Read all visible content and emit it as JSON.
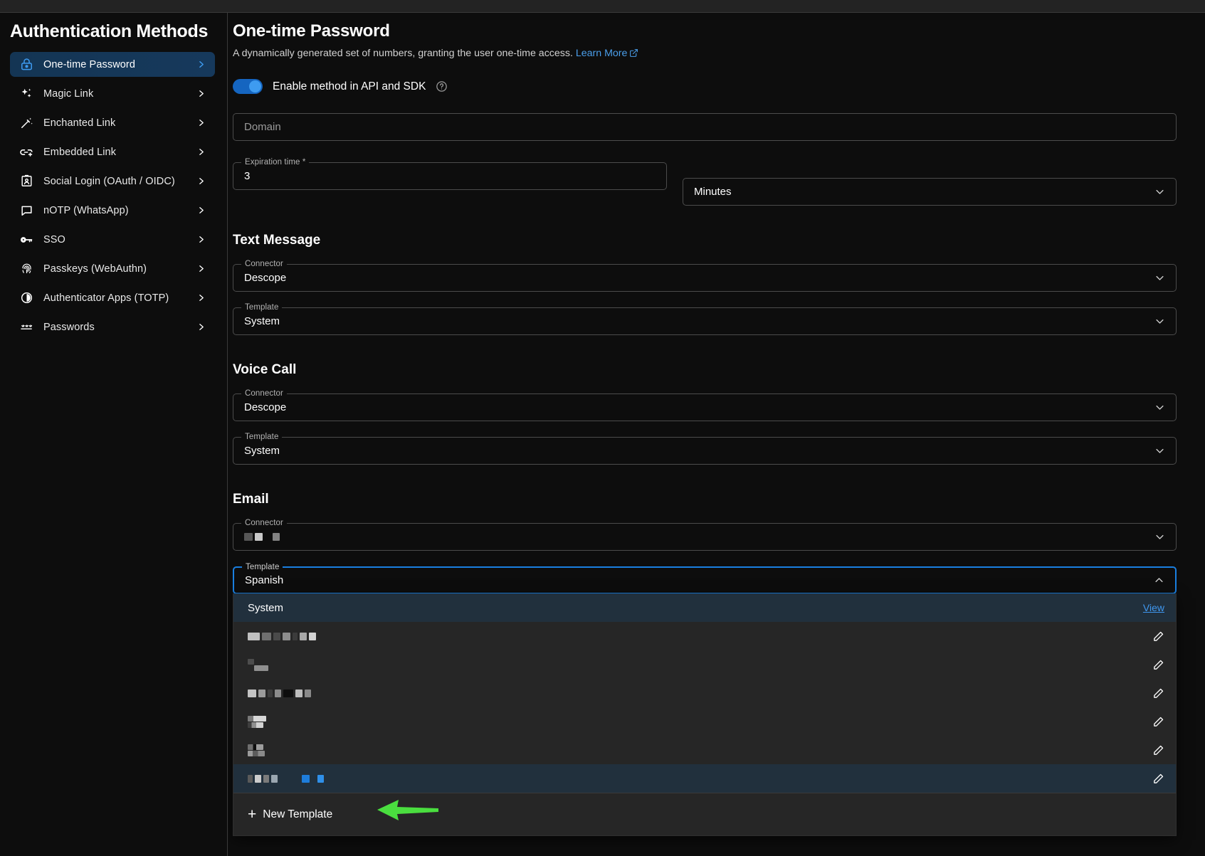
{
  "sidebar": {
    "title": "Authentication Methods",
    "items": [
      {
        "label": "One-time Password",
        "icon": "lock-clock-icon",
        "active": true
      },
      {
        "label": "Magic Link",
        "icon": "sparkles-icon",
        "active": false
      },
      {
        "label": "Enchanted Link",
        "icon": "magic-wand-icon",
        "active": false
      },
      {
        "label": "Embedded Link",
        "icon": "embed-link-icon",
        "active": false
      },
      {
        "label": "Social Login (OAuth / OIDC)",
        "icon": "id-badge-icon",
        "active": false
      },
      {
        "label": "nOTP (WhatsApp)",
        "icon": "chat-bubble-icon",
        "active": false
      },
      {
        "label": "SSO",
        "icon": "key-icon",
        "active": false
      },
      {
        "label": "Passkeys (WebAuthn)",
        "icon": "fingerprint-icon",
        "active": false
      },
      {
        "label": "Authenticator Apps (TOTP)",
        "icon": "clock-pie-icon",
        "active": false
      },
      {
        "label": "Passwords",
        "icon": "dots-password-icon",
        "active": false
      }
    ]
  },
  "main": {
    "title": "One-time Password",
    "description": "A dynamically generated set of numbers, granting the user one-time access.",
    "learn_more": "Learn More",
    "toggle": {
      "label": "Enable method in API and SDK",
      "enabled": true,
      "help_icon": "question-circle-icon"
    },
    "domain": {
      "placeholder": "Domain",
      "value": ""
    },
    "expiration": {
      "legend": "Expiration time *",
      "value": "3"
    },
    "expiration_unit": {
      "value": "Minutes"
    },
    "text_message": {
      "heading": "Text Message",
      "connector": {
        "legend": "Connector",
        "value": "Descope"
      },
      "template": {
        "legend": "Template",
        "value": "System"
      }
    },
    "voice_call": {
      "heading": "Voice Call",
      "connector": {
        "legend": "Connector",
        "value": "Descope"
      },
      "template": {
        "legend": "Template",
        "value": "System"
      }
    },
    "email": {
      "heading": "Email",
      "connector": {
        "legend": "Connector",
        "value": "",
        "redacted": true
      },
      "template": {
        "legend": "Template",
        "value": "Spanish",
        "focused": true,
        "open": true
      }
    },
    "template_dropdown": {
      "options": [
        {
          "label": "System",
          "redacted": false,
          "selected": true,
          "action": "View",
          "action_type": "link"
        },
        {
          "label": "",
          "redacted": true,
          "selected": false,
          "action": "edit",
          "action_type": "pencil"
        },
        {
          "label": "",
          "redacted": true,
          "selected": false,
          "action": "edit",
          "action_type": "pencil"
        },
        {
          "label": "",
          "redacted": true,
          "selected": false,
          "action": "edit",
          "action_type": "pencil"
        },
        {
          "label": "",
          "redacted": true,
          "selected": false,
          "action": "edit",
          "action_type": "pencil"
        },
        {
          "label": "",
          "redacted": true,
          "selected": false,
          "action": "edit",
          "action_type": "pencil"
        },
        {
          "label": "",
          "redacted": true,
          "selected": true,
          "action": "edit",
          "action_type": "pencil"
        }
      ],
      "footer": {
        "label": "New Template",
        "icon": "plus-icon"
      }
    },
    "annotation": {
      "type": "arrow-left",
      "color": "#4ade3f",
      "points_to": "New Template"
    }
  },
  "colors": {
    "accent": "#3e9bf0",
    "link": "#4a9eea",
    "selected_row": "#21303d",
    "annotation_green": "#4ade3f",
    "background": "#0d0d0d",
    "dropdown_bg": "#262626"
  }
}
